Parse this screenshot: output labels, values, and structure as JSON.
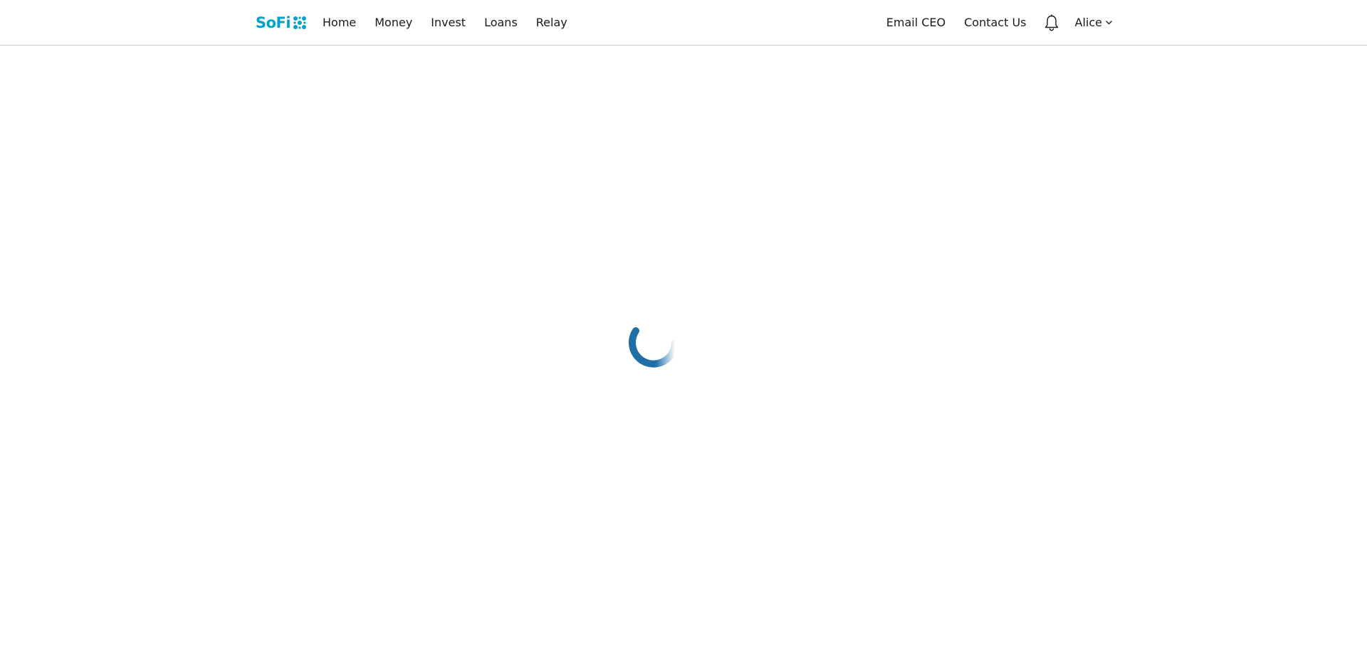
{
  "brand": {
    "name": "SoFi",
    "color": "#00a2c7",
    "mark_icon": "sofi-mark-icon"
  },
  "nav": {
    "items": [
      {
        "label": "Home"
      },
      {
        "label": "Money"
      },
      {
        "label": "Invest"
      },
      {
        "label": "Loans"
      },
      {
        "label": "Relay"
      }
    ]
  },
  "header_right": {
    "email_ceo_label": "Email CEO",
    "contact_label": "Contact Us",
    "notifications_icon": "bell-icon",
    "user_name": "Alice",
    "user_menu_icon": "chevron-down-icon"
  },
  "main": {
    "state_icon": "loading-spinner-icon",
    "spinner_color": "#1d6fa5"
  }
}
